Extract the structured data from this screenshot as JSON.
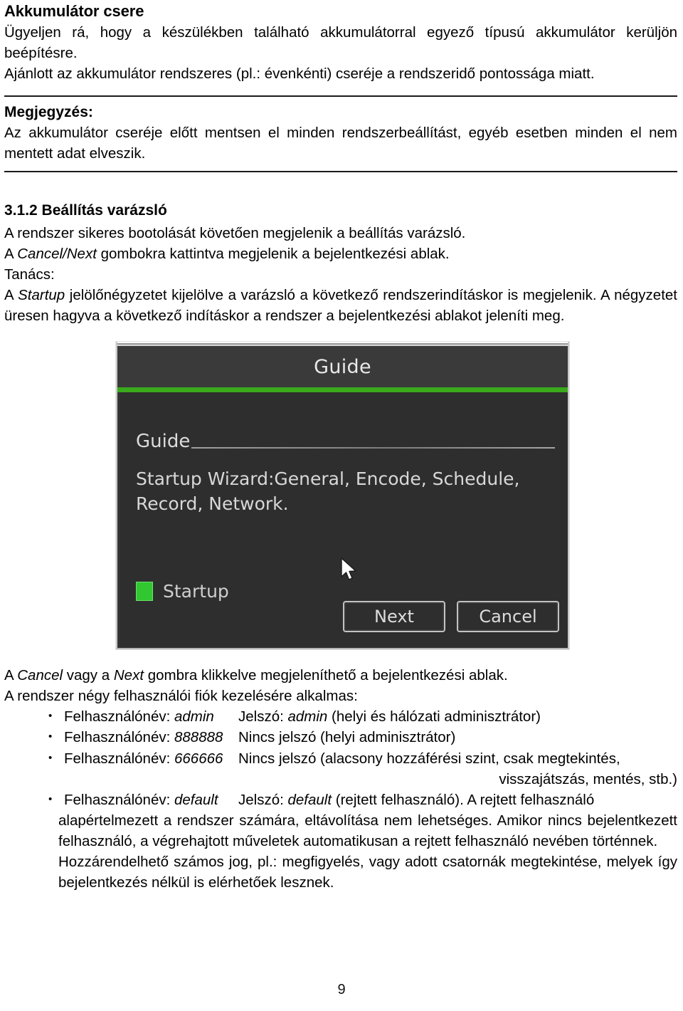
{
  "document": {
    "heading": "Akkumulátor csere",
    "intro_paragraph_1": "Ügyeljen rá, hogy a készülékben található akkumulátorral egyező típusú akkumulátor kerüljön beépítésre.",
    "intro_paragraph_2": "Ajánlott az akkumulátor rendszeres (pl.: évenkénti) cseréje a rendszeridő pontossága miatt."
  },
  "note_box": {
    "title": "Megjegyzés:",
    "text": "Az akkumulátor cseréje előtt mentsen el minden rendszerbeállítást, egyéb esetben minden el nem mentett adat elveszik."
  },
  "section": {
    "number": "3.1.2",
    "title": "3.1.2 Beállítás varázsló",
    "paragraph_1": "A rendszer sikeres bootolását követően megjelenik a beállítás varázsló.",
    "paragraph_2_pre": "A ",
    "paragraph_2_italic": "Cancel/Next",
    "paragraph_2_post": " gombokra kattintva megjelenik a bejelentkezési ablak.",
    "tip_label": "Tanács:",
    "tip_pre": "A ",
    "tip_italic": "Startup",
    "tip_post": " jelölőnégyzetet kijelölve a varázsló a következő rendszerindításkor is megjelenik. A négyzetet üresen hagyva a következő indításkor a rendszer a bejelentkezési ablakot jeleníti meg."
  },
  "screenshot": {
    "window_title": "Guide",
    "field_label": "Guide",
    "description": "Startup Wizard:General, Encode, Schedule, Record, Network.",
    "checkbox_label": "Startup",
    "checkbox_checked": true,
    "buttons": {
      "next": "Next",
      "cancel": "Cancel"
    },
    "colors": {
      "accent_green": "#3aa91b",
      "checkbox_green": "#31c731",
      "titlebar": "#3a3a3a",
      "body": "#2e2e2e"
    }
  },
  "after_image": {
    "line1_pre": "A ",
    "line1_italic_1": "Cancel",
    "line1_mid": " vagy a ",
    "line1_italic_2": "Next",
    "line1_post": " gombra klikkelve megjeleníthető a bejelentkezési ablak.",
    "line2": "A rendszer négy felhasználói fiók kezelésére alkalmas:"
  },
  "accounts": [
    {
      "bullet": "•",
      "user_label": "Felhasználónév: ",
      "user_value": "admin",
      "password_text": "Jelszó: ",
      "password_value": "admin",
      "password_note": " (helyi és hálózati adminisztrátor)"
    },
    {
      "bullet": "•",
      "user_label": "Felhasználónév: ",
      "user_value": "888888",
      "password_text": "Nincs jelszó (helyi adminisztrátor)",
      "password_value": "",
      "password_note": ""
    },
    {
      "bullet": "•",
      "user_label": "Felhasználónév: ",
      "user_value": "666666",
      "password_text": "Nincs jelszó (alacsony hozzáférési szint, csak megtekintés,",
      "password_value": "",
      "password_note": "visszajátszás, mentés, stb.)"
    },
    {
      "bullet": "•",
      "user_label": "Felhasználónév: ",
      "user_value": "default",
      "password_text": "Jelszó: ",
      "password_value": "default",
      "password_note": " (rejtett felhasználó). A rejtett felhasználó"
    }
  ],
  "default_account_detail": {
    "line_a": "alapértelmezett a rendszer számára, eltávolítása nem lehetséges. Amikor nincs bejelentkezett felhasználó, a végrehajtott műveletek automatikusan a rejtett felhasználó nevében történnek.",
    "line_b": "Hozzárendelhető számos jog, pl.: megfigyelés, vagy adott csatornák megtekintése, melyek így bejelentkezés nélkül is elérhetőek lesznek."
  },
  "footer": {
    "page_number": "9"
  }
}
